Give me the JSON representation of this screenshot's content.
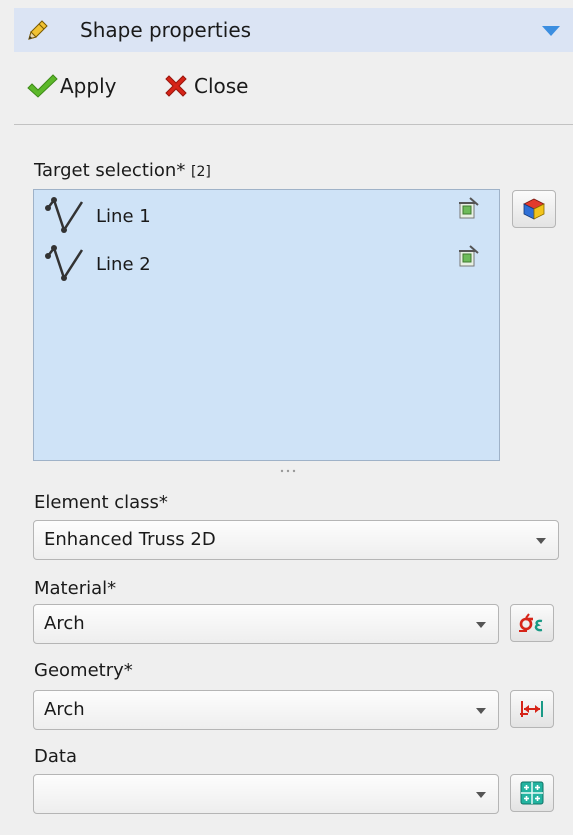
{
  "header": {
    "title": "Shape properties"
  },
  "toolbar": {
    "apply_label": "Apply",
    "close_label": "Close"
  },
  "target_selection": {
    "label": "Target selection*",
    "count": "[2]",
    "items": [
      {
        "label": "Line 1",
        "icon": "line-icon"
      },
      {
        "label": "Line 2",
        "icon": "line-icon"
      }
    ]
  },
  "element_class": {
    "label": "Element class*",
    "value": "Enhanced Truss 2D"
  },
  "material": {
    "label": "Material*",
    "value": "Arch"
  },
  "geometry": {
    "label": "Geometry*",
    "value": "Arch"
  },
  "data_field": {
    "label": "Data",
    "value": ""
  },
  "colors": {
    "header_bg": "#dbe4f4",
    "list_bg": "#cfe3f7",
    "collapse_arrow": "#3c8ee0",
    "apply_check": "#5cb82a",
    "close_x": "#d62418"
  }
}
